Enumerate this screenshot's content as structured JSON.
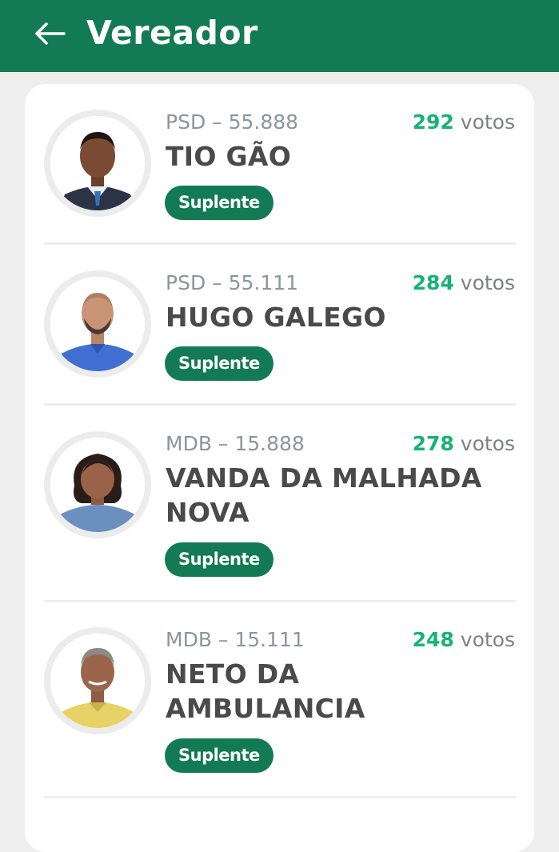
{
  "header": {
    "title": "Vereador",
    "back_icon": "arrow-left-icon",
    "background": "#127a55"
  },
  "colors": {
    "accent": "#127a55",
    "votes_number": "#15b374"
  },
  "candidates": [
    {
      "party": "PSD – 55.888",
      "votes": "292",
      "votes_label": "votos",
      "name": "TIO GÃO",
      "status": "Suplente"
    },
    {
      "party": "PSD – 55.111",
      "votes": "284",
      "votes_label": "votos",
      "name": "HUGO GALEGO",
      "status": "Suplente"
    },
    {
      "party": "MDB – 15.888",
      "votes": "278",
      "votes_label": "votos",
      "name": "VANDA DA MALHADA NOVA",
      "status": "Suplente"
    },
    {
      "party": "MDB – 15.111",
      "votes": "248",
      "votes_label": "votos",
      "name": "NETO DA AMBULANCIA",
      "status": "Suplente"
    }
  ]
}
